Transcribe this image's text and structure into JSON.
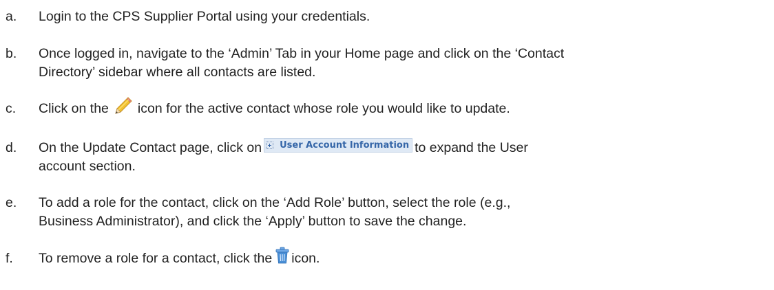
{
  "doc": {
    "steps": [
      {
        "letter": "a.",
        "lines": [
          "Login to the CPS Supplier Portal using your credentials."
        ]
      },
      {
        "letter": "b.",
        "lines": [
          "Once logged in, navigate to the ‘Admin’ Tab in your Home page and click on the ‘Contact",
          "Directory’ sidebar where all contacts are listed."
        ]
      },
      {
        "letter": "c.",
        "before": "Click on the",
        "icon": "pencil-icon",
        "after": "icon for the active contact whose role you would like to update."
      },
      {
        "letter": "d.",
        "before": "On the Update Contact page, click on",
        "button_label": "User Account Information",
        "after": "to expand the User",
        "line2": "account section."
      },
      {
        "letter": "e.",
        "lines": [
          "To add a role for the contact, click on the ‘Add Role’ button, select the role (e.g.,",
          "Business Administrator), and click the ‘Apply’ button to save the change."
        ]
      },
      {
        "letter": "f.",
        "before": "To remove a role for a contact, click the",
        "icon": "trash-icon",
        "after": "icon."
      }
    ],
    "colors": {
      "text": "#222222",
      "button_bg": "#dfe9f5",
      "button_text": "#3566a8",
      "pencil": "#f2c230",
      "trash": "#4a8fd6"
    }
  }
}
